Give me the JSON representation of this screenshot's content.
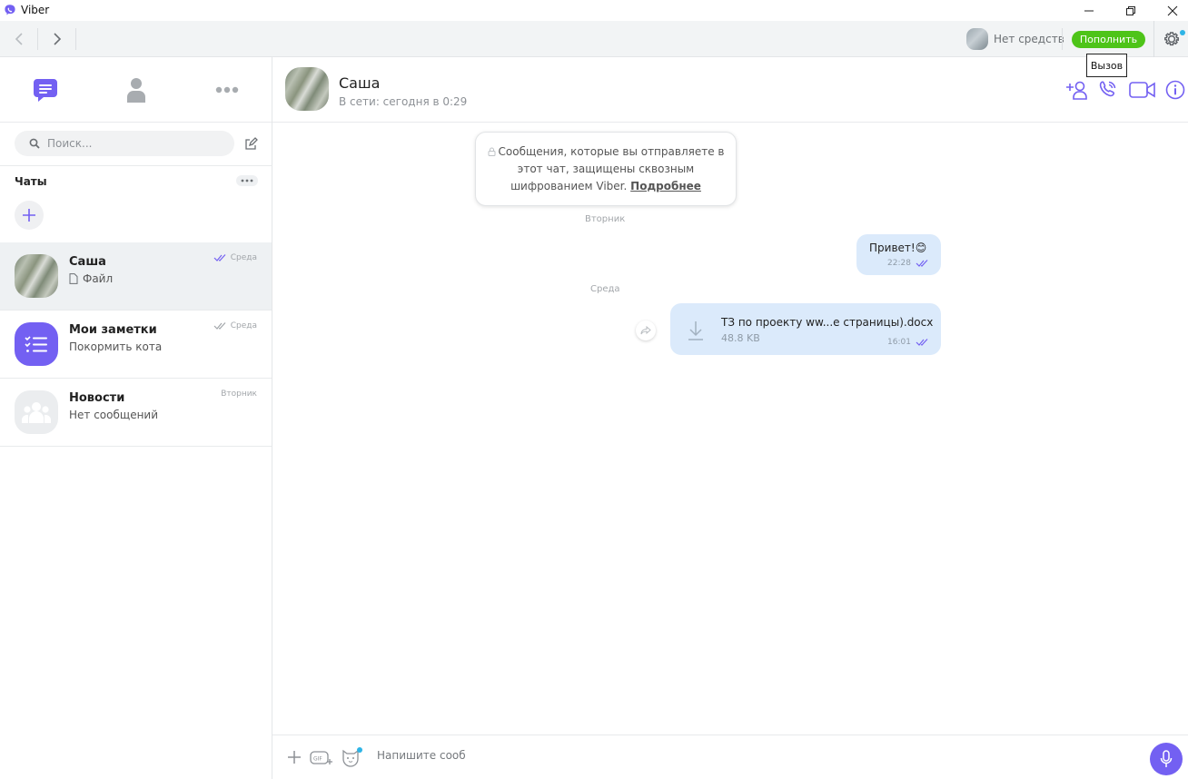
{
  "window": {
    "title": "Viber",
    "icon": "viber-logo-icon"
  },
  "topbar": {
    "balance_text": "Нет средств",
    "topup_label": "Пополнить",
    "tooltip": "Вызов",
    "colors": {
      "topup": "#4ec419",
      "accent": "#7360f2"
    }
  },
  "sidebar": {
    "search_placeholder": "Поиск...",
    "chats_header": "Чаты",
    "chats": [
      {
        "name": "Саша",
        "preview": "Файл",
        "time": "Среда",
        "active": true,
        "read": true
      },
      {
        "name": "Мои заметки",
        "preview": "Покормить кота",
        "time": "Среда",
        "active": false,
        "read": true
      },
      {
        "name": "Новости",
        "preview": "Нет сообщений",
        "time": "Вторник",
        "active": false,
        "read": false
      }
    ]
  },
  "chat": {
    "contact_name": "Саша",
    "status": "В сети: сегодня в 0:29",
    "notice_text": "Сообщения, которые вы отправляете в этот чат, защищены сквозным шифрованием Viber.",
    "notice_link": "Подробнее",
    "day_labels": [
      "Вторник",
      "Среда"
    ],
    "messages": [
      {
        "text": "Привет!",
        "emoji": "😊",
        "time": "22:28"
      },
      {
        "file_name": "ТЗ по проекту ww...е страницы).docx",
        "file_size": "48.8 KB",
        "time": "16:01"
      }
    ],
    "composer_placeholder": "Напишите сооб"
  }
}
